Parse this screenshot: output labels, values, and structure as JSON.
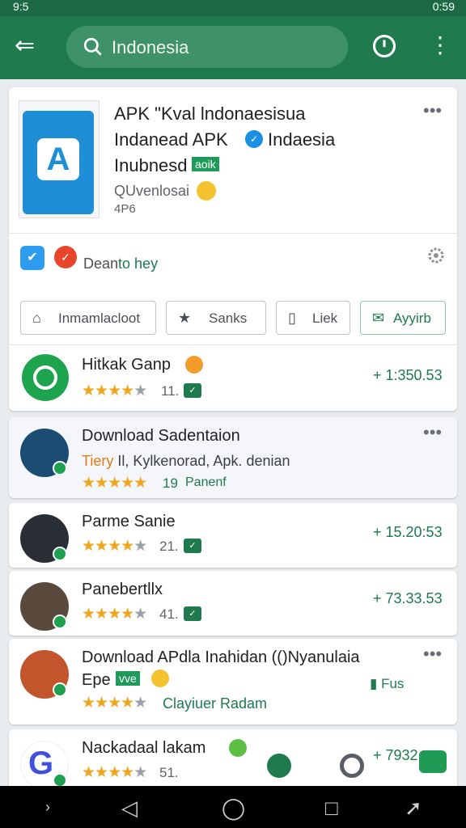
{
  "status": {
    "left": "9:5",
    "time": "0:59"
  },
  "appbar": {
    "search_value": "Indonesia",
    "colors": {
      "bar": "#1f7a4d",
      "accent": "#1e9b5a"
    }
  },
  "hero": {
    "title_line1": "APK \"Kval lndonaesisua",
    "title_line2a": "Indanead APK",
    "title_line2b": "Indaesia",
    "title_line3": "Inubnesd",
    "badge": "aoik",
    "subtitle": "QUvenlosai",
    "version": "4P6",
    "developer_prefix": "Dean",
    "developer_highlight": "to hey",
    "buttons": [
      "Inmamlacloot",
      "Sanks",
      "Liek",
      "Ayyirb"
    ]
  },
  "featured_row": {
    "name": "Hitkak Ganp",
    "rating": 4,
    "count": "11.",
    "price": "+ 1:350.53"
  },
  "list": [
    {
      "name": "Download Sadentaion",
      "line2_orange": "Tiery",
      "line2_rest": "Il, Kylkenorad, Apk. denian",
      "rating": 5,
      "count": "19",
      "teal": "Panenf"
    },
    {
      "name": "Parme Sanie",
      "rating": 4,
      "count": "21.",
      "price": "+ 15.20:53"
    },
    {
      "name": "Panebertllx",
      "rating": 4,
      "count": "41.",
      "price": "+ 73.33.53"
    },
    {
      "name": "Download APdla Inahidan (()Nyanulaia",
      "line2": "Epe",
      "badge": "vve",
      "rating": 4,
      "teal": "Clayiuer Radam",
      "fans": "Fus"
    },
    {
      "name": "Nackadaal lakam",
      "rating": 4,
      "count": "51.",
      "price": "+ 7932"
    }
  ]
}
